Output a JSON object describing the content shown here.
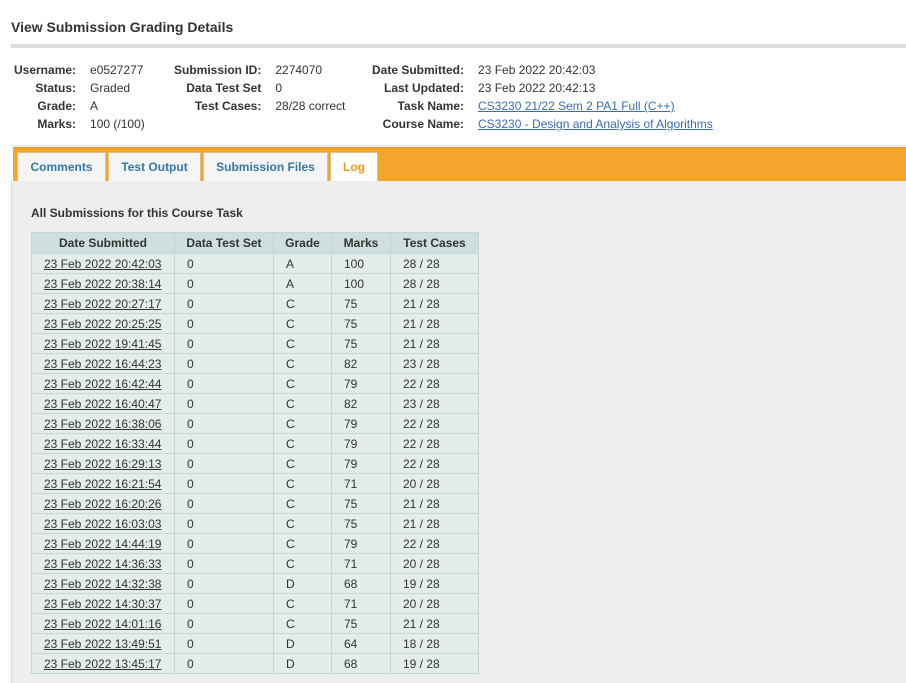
{
  "page_title": "View Submission Grading Details",
  "info": {
    "col1": [
      {
        "label": "Username:",
        "value": "e0527277"
      },
      {
        "label": "Status:",
        "value": "Graded"
      },
      {
        "label": "Grade:",
        "value": "A"
      },
      {
        "label": "Marks:",
        "value": "100 (/100)"
      }
    ],
    "col2": [
      {
        "label": "Submission ID:",
        "value": "2274070"
      },
      {
        "label": "Data Test Set",
        "value": "0"
      },
      {
        "label": "Test Cases:",
        "value": "28/28 correct"
      }
    ],
    "col3": [
      {
        "label": "Date Submitted:",
        "value": "23 Feb 2022 20:42:03"
      },
      {
        "label": "Last Updated:",
        "value": "23 Feb 2022 20:42:13"
      },
      {
        "label": "Task Name:",
        "value": "CS3230 21/22 Sem 2 PA1 Full (C++)"
      },
      {
        "label": "Course Name:",
        "value": "CS3230 - Design and Analysis of Algorithms"
      }
    ]
  },
  "tabs": [
    {
      "label": "Comments",
      "active": false
    },
    {
      "label": "Test Output",
      "active": false
    },
    {
      "label": "Submission Files",
      "active": false
    },
    {
      "label": "Log",
      "active": true
    }
  ],
  "submissions": {
    "title": "All Submissions for this Course Task",
    "headers": [
      "Date Submitted",
      "Data Test Set",
      "Grade",
      "Marks",
      "Test Cases"
    ],
    "rows": [
      [
        "23 Feb 2022 20:42:03",
        "0",
        "A",
        "100",
        "28 / 28"
      ],
      [
        "23 Feb 2022 20:38:14",
        "0",
        "A",
        "100",
        "28 / 28"
      ],
      [
        "23 Feb 2022 20:27:17",
        "0",
        "C",
        "75",
        "21 / 28"
      ],
      [
        "23 Feb 2022 20:25:25",
        "0",
        "C",
        "75",
        "21 / 28"
      ],
      [
        "23 Feb 2022 19:41:45",
        "0",
        "C",
        "75",
        "21 / 28"
      ],
      [
        "23 Feb 2022 16:44:23",
        "0",
        "C",
        "82",
        "23 / 28"
      ],
      [
        "23 Feb 2022 16:42:44",
        "0",
        "C",
        "79",
        "22 / 28"
      ],
      [
        "23 Feb 2022 16:40:47",
        "0",
        "C",
        "82",
        "23 / 28"
      ],
      [
        "23 Feb 2022 16:38:06",
        "0",
        "C",
        "79",
        "22 / 28"
      ],
      [
        "23 Feb 2022 16:33:44",
        "0",
        "C",
        "79",
        "22 / 28"
      ],
      [
        "23 Feb 2022 16:29:13",
        "0",
        "C",
        "79",
        "22 / 28"
      ],
      [
        "23 Feb 2022 16:21:54",
        "0",
        "C",
        "71",
        "20 / 28"
      ],
      [
        "23 Feb 2022 16:20:26",
        "0",
        "C",
        "75",
        "21 / 28"
      ],
      [
        "23 Feb 2022 16:03:03",
        "0",
        "C",
        "75",
        "21 / 28"
      ],
      [
        "23 Feb 2022 14:44:19",
        "0",
        "C",
        "79",
        "22 / 28"
      ],
      [
        "23 Feb 2022 14:36:33",
        "0",
        "C",
        "71",
        "20 / 28"
      ],
      [
        "23 Feb 2022 14:32:38",
        "0",
        "D",
        "68",
        "19 / 28"
      ],
      [
        "23 Feb 2022 14:30:37",
        "0",
        "C",
        "71",
        "20 / 28"
      ],
      [
        "23 Feb 2022 14:01:16",
        "0",
        "C",
        "75",
        "21 / 28"
      ],
      [
        "23 Feb 2022 13:49:51",
        "0",
        "D",
        "64",
        "18 / 28"
      ],
      [
        "23 Feb 2022 13:45:17",
        "0",
        "D",
        "68",
        "19 / 28"
      ]
    ]
  },
  "colors": {
    "tab_bar": "#f4a52c",
    "active_tab_text": "#f29a1a",
    "tab_text": "#3478a8",
    "link": "#3a6bb5"
  }
}
